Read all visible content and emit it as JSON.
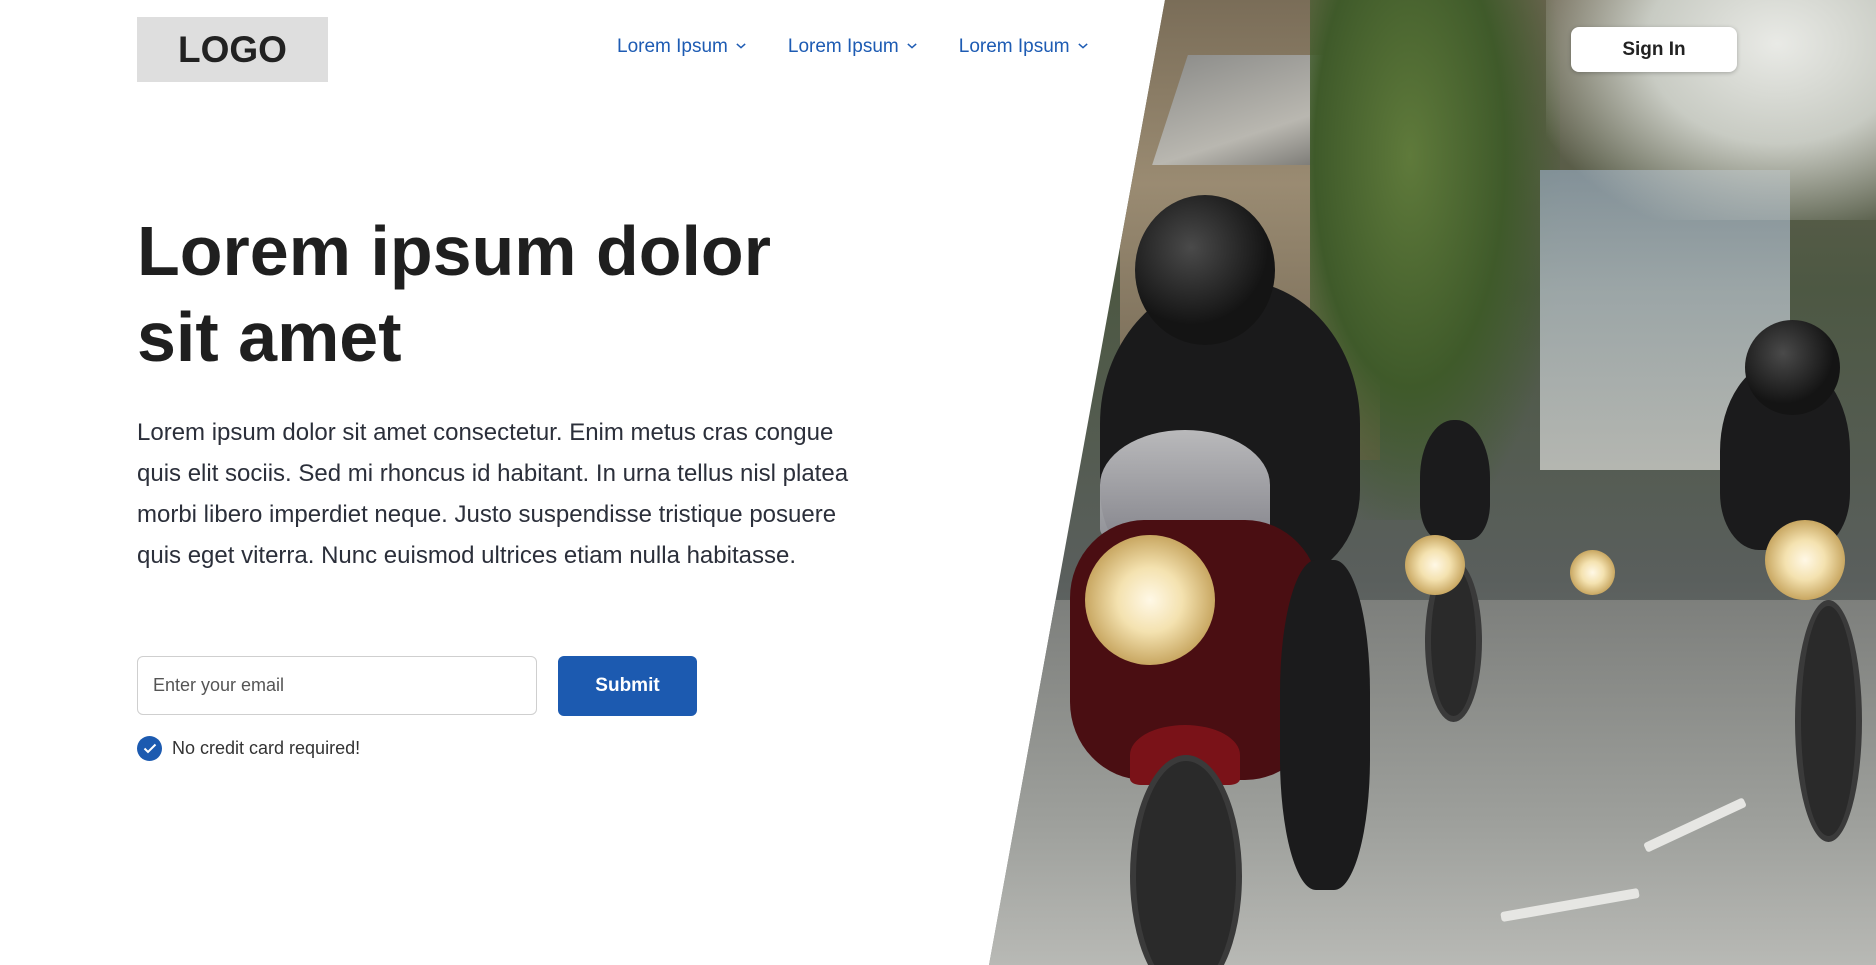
{
  "header": {
    "logo_text": "LOGO",
    "nav": [
      {
        "label": "Lorem Ipsum",
        "icon": "chevron-down-icon"
      },
      {
        "label": "Lorem Ipsum",
        "icon": "chevron-down-icon"
      },
      {
        "label": "Lorem Ipsum",
        "icon": "chevron-down-icon"
      }
    ],
    "signin_label": "Sign In"
  },
  "hero": {
    "title_line1": "Lorem ipsum dolor",
    "title_line2": "sit amet",
    "body": "Lorem ipsum dolor sit amet consectetur. Enim metus cras congue quis elit sociis. Sed mi rhoncus id habitant. In urna tellus nisl platea morbi libero imperdiet neque. Justo suspendisse tristique posuere quis eget viterra. Nunc euismod ultrices etiam nulla habitasse.",
    "email_placeholder": "Enter your email",
    "email_value": "",
    "submit_label": "Submit",
    "note": "No credit card required!",
    "note_icon": "check-circle-icon"
  },
  "colors": {
    "accent": "#1c5ab0",
    "nav_link": "#1d5bb3",
    "logo_bg": "#dedede",
    "text": "#1f1f1f"
  }
}
